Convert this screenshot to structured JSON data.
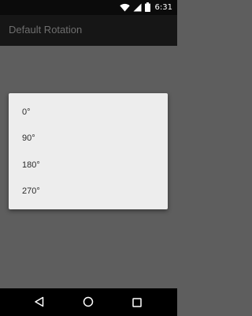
{
  "status_bar": {
    "time": "6:31",
    "icons": [
      "wifi-icon",
      "signal-icon",
      "battery-icon"
    ]
  },
  "app_bar": {
    "title": "Default Rotation"
  },
  "dialog": {
    "options": [
      {
        "label": "0°"
      },
      {
        "label": "90°"
      },
      {
        "label": "180°"
      },
      {
        "label": "270°"
      }
    ]
  },
  "nav_bar": {
    "buttons": [
      "back-icon",
      "home-icon",
      "recents-icon"
    ]
  },
  "colors": {
    "status_bar": "#0b0b0b",
    "app_bar": "#161616",
    "scrim": "#5e5e5e",
    "dialog_bg": "#ededed",
    "option_text": "#2c2c2c",
    "nav_bar": "#000000"
  }
}
